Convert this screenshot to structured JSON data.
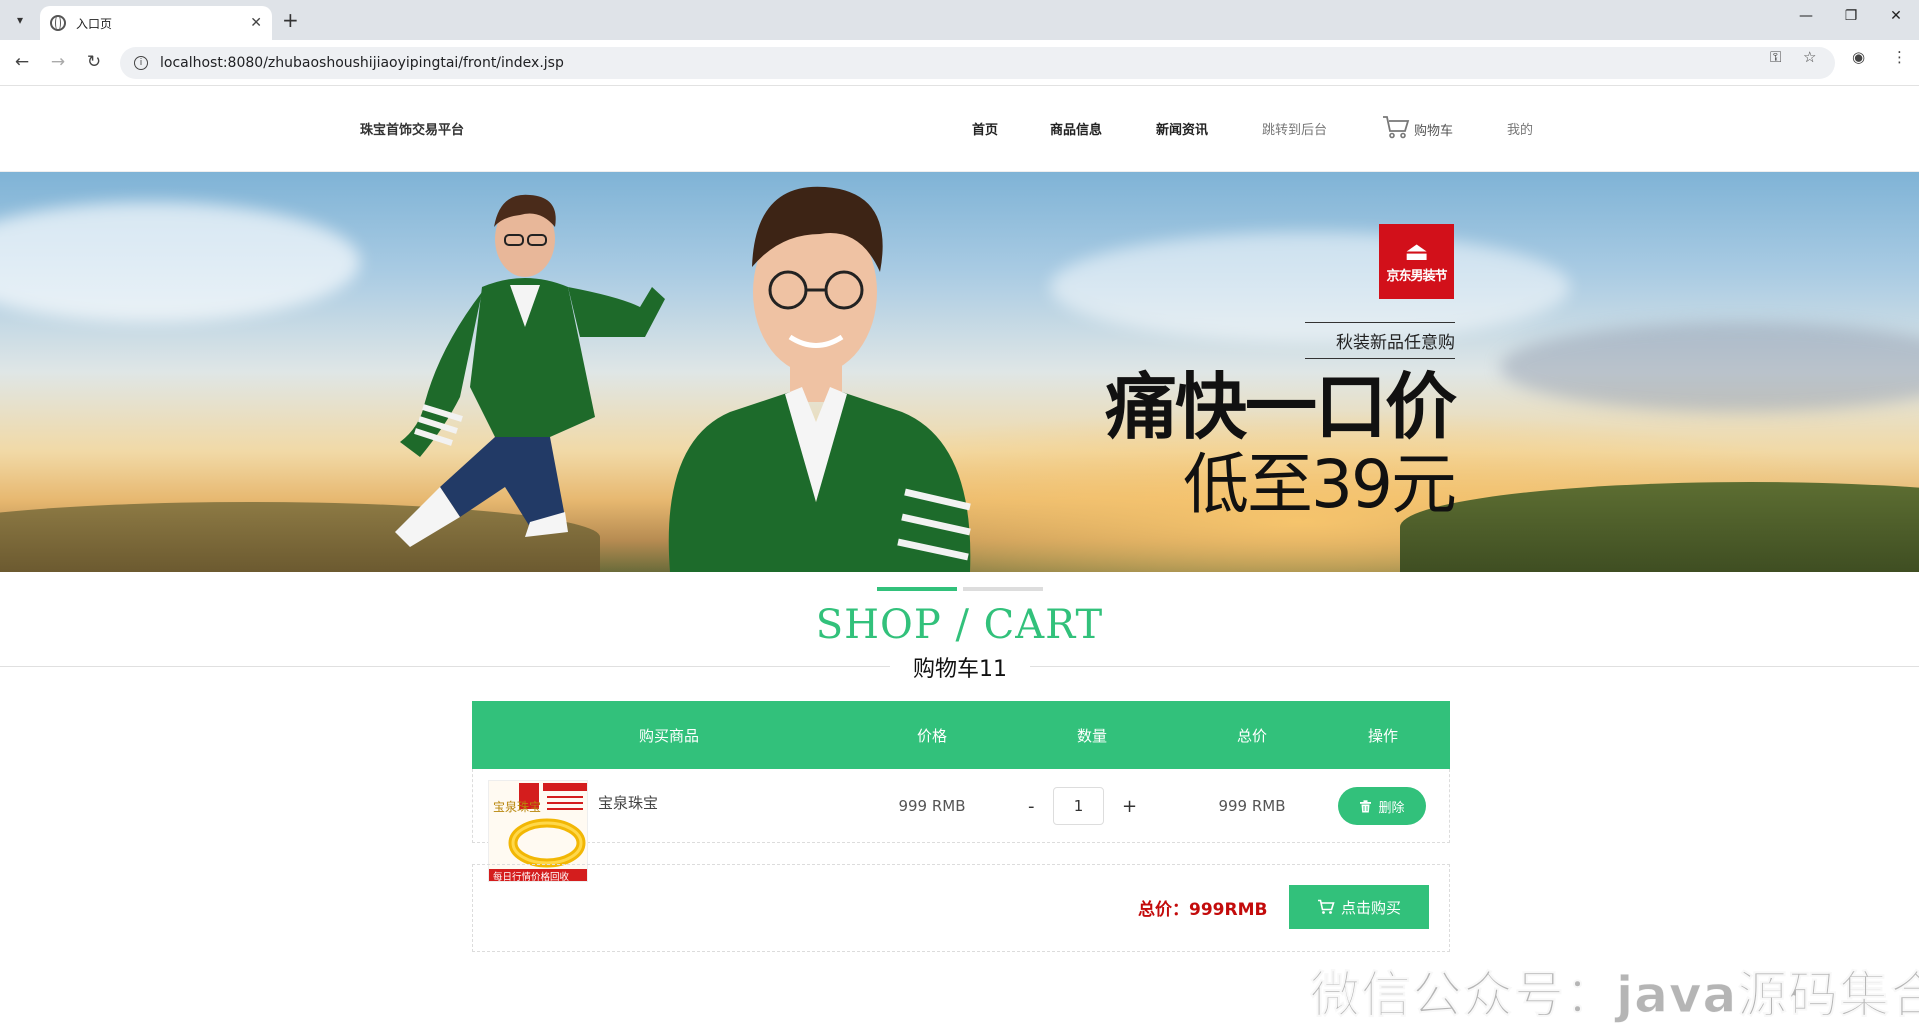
{
  "browser": {
    "tab_title": "入口页",
    "url": "localhost:8080/zhubaoshoushijiaoyipingtai/front/index.jsp"
  },
  "header": {
    "site_title": "珠宝首饰交易平台",
    "nav": {
      "home": "首页",
      "goods": "商品信息",
      "news": "新闻资讯",
      "admin": "跳转到后台",
      "cart": "购物车",
      "mine": "我的"
    }
  },
  "banner": {
    "logo_text": "京东男装节",
    "subtitle": "秋装新品任意购",
    "headline": "痛快一口价",
    "price_line": "低至39元"
  },
  "section": {
    "title": "SHOP / CART",
    "subtitle": "购物车11"
  },
  "cart": {
    "columns": [
      "购买商品",
      "价格",
      "数量",
      "总价",
      "操作"
    ],
    "items": [
      {
        "name": "宝泉珠宝",
        "price": "999 RMB",
        "quantity": "1",
        "total": "999 RMB",
        "delete_label": "删除",
        "image_text": {
          "brand": "宝泉珠宝",
          "bottom_banner": "每日行情价格回收"
        }
      }
    ],
    "qty_minus": "-",
    "qty_plus": "+",
    "total_label": "总价：999RMB",
    "buy_label": "点击购买"
  },
  "watermark": "微信公众号：java源码集合",
  "colors": {
    "accent": "#32c17b",
    "price_red": "#c30b0b",
    "logo_red": "#d2101a"
  }
}
